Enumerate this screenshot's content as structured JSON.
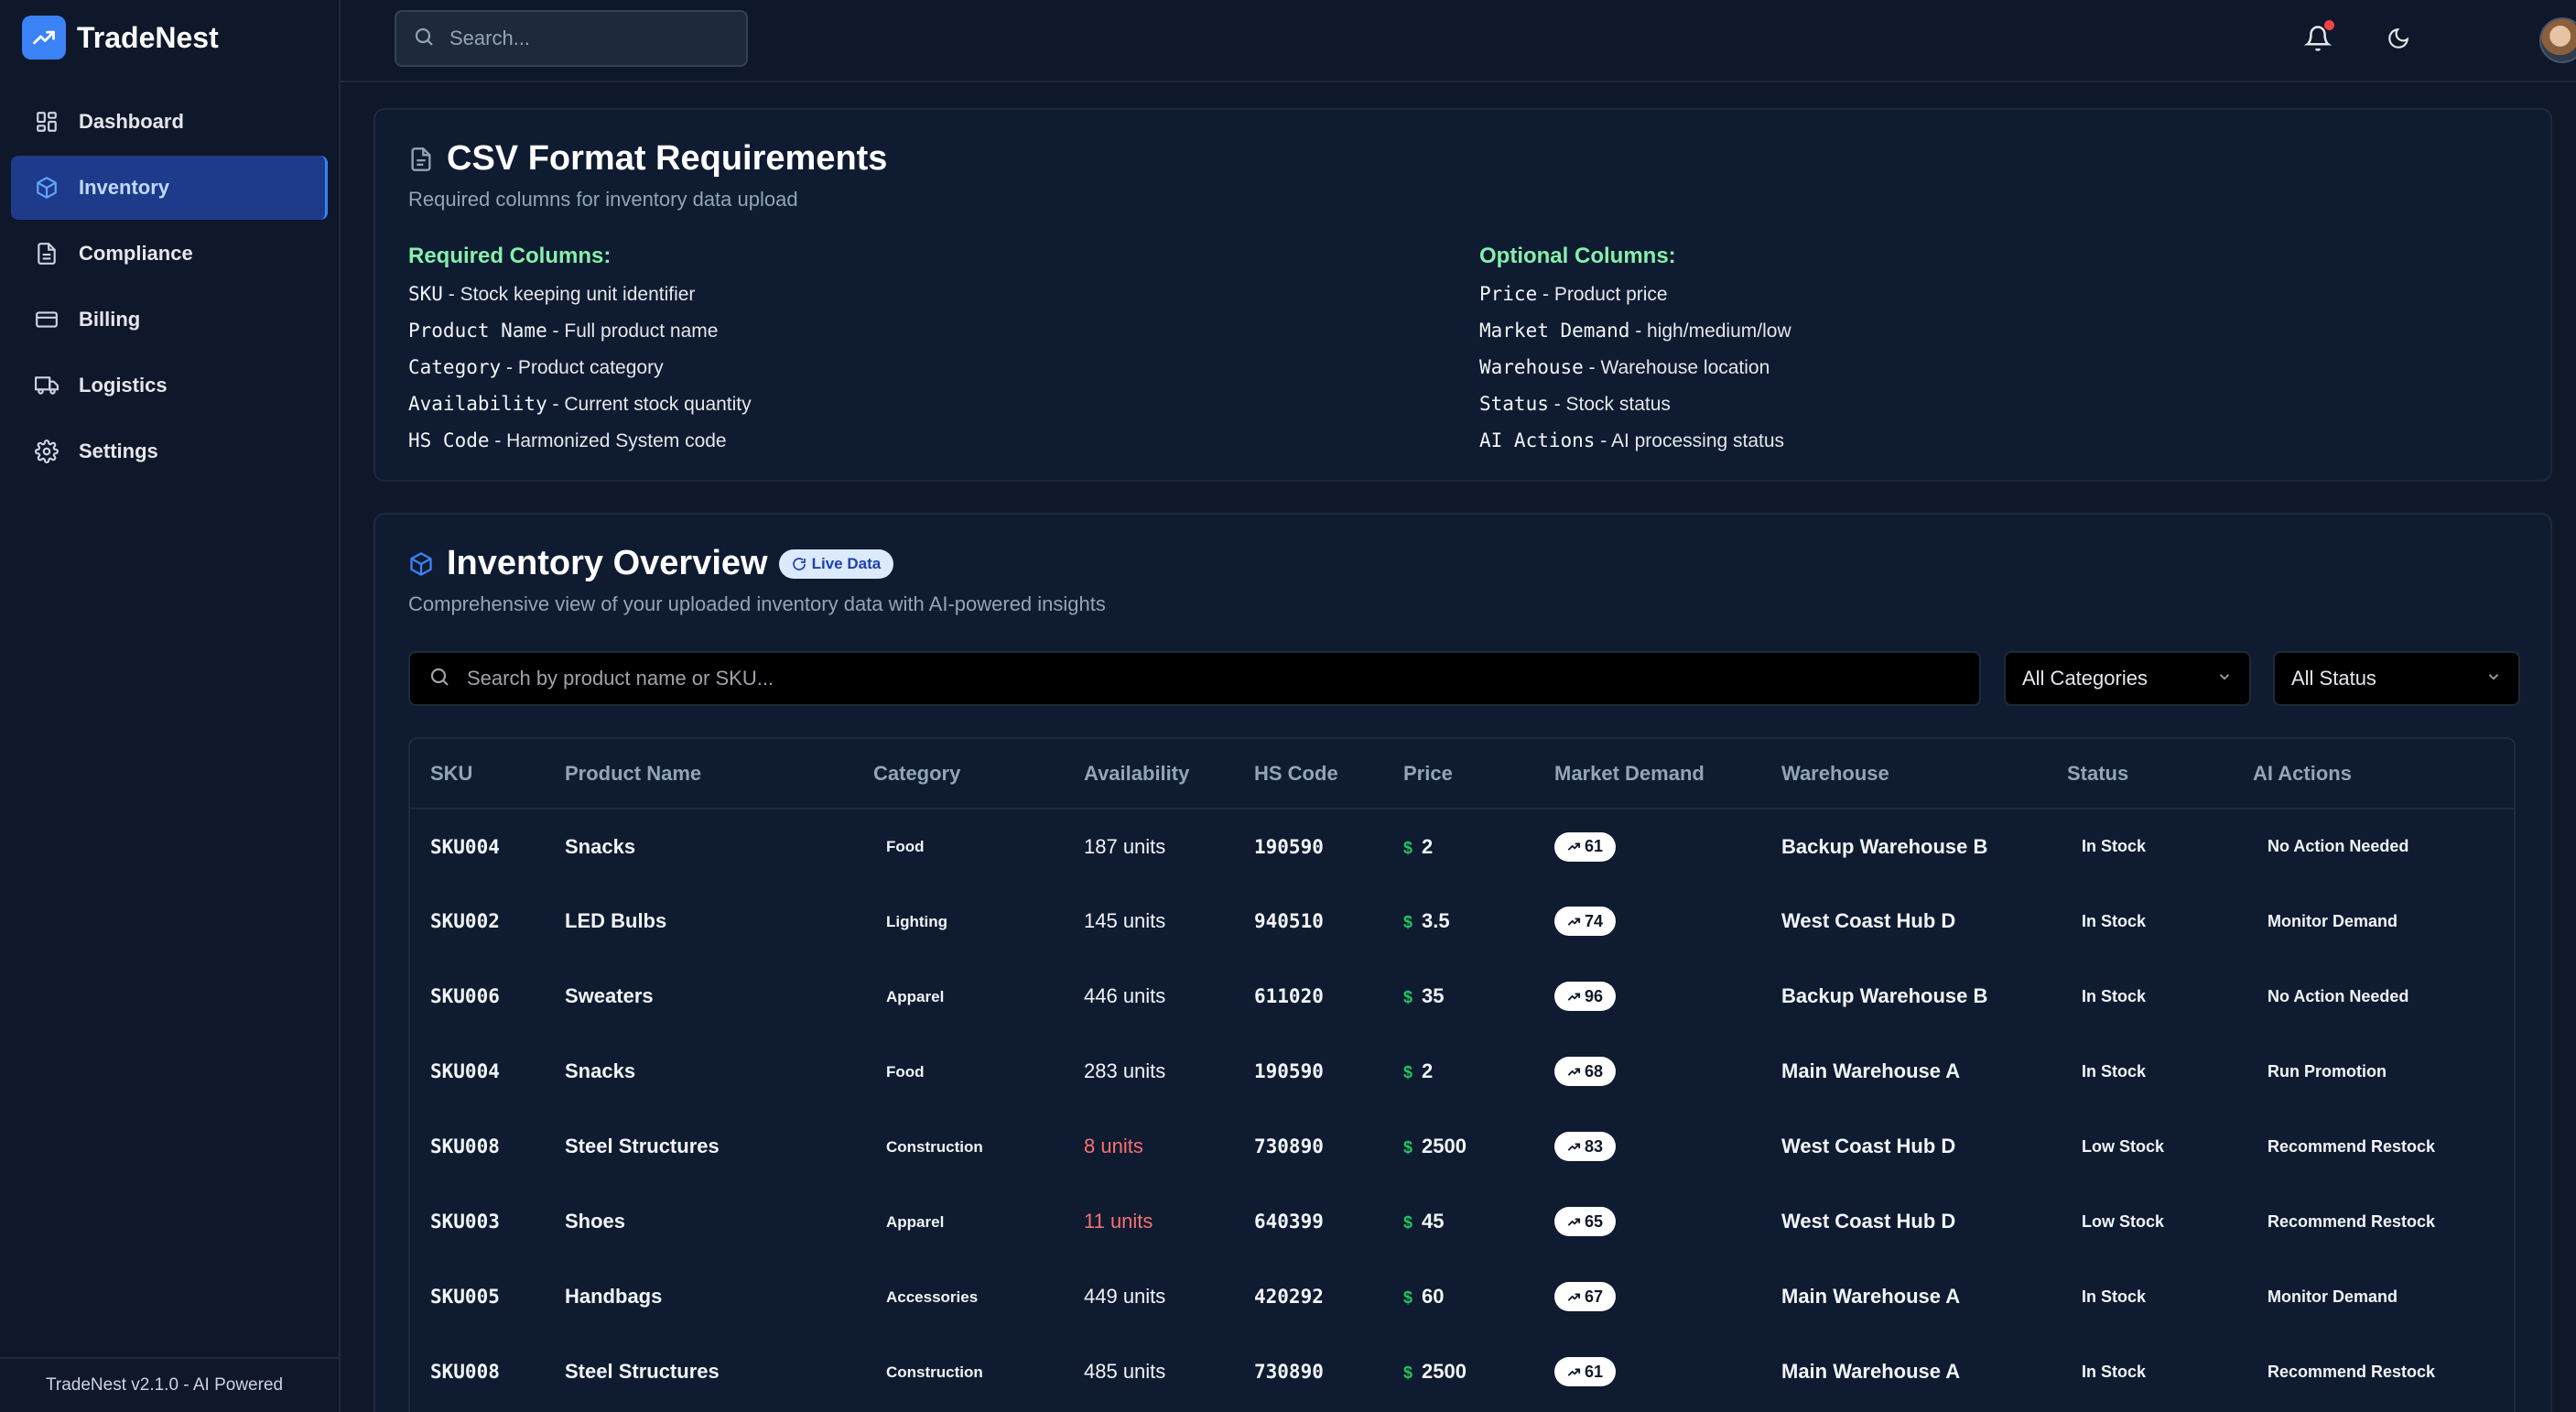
{
  "app": {
    "name": "TradeNest",
    "version_footer": "TradeNest v2.1.0 - AI Powered"
  },
  "topbar": {
    "search_placeholder": "Search..."
  },
  "sidebar": {
    "items": [
      {
        "label": "Dashboard",
        "icon": "dashboard-icon"
      },
      {
        "label": "Inventory",
        "icon": "box-icon",
        "active": true
      },
      {
        "label": "Compliance",
        "icon": "document-icon"
      },
      {
        "label": "Billing",
        "icon": "credit-card-icon"
      },
      {
        "label": "Logistics",
        "icon": "truck-icon"
      },
      {
        "label": "Settings",
        "icon": "gear-icon"
      }
    ]
  },
  "csv": {
    "title": "CSV Format Requirements",
    "subtitle": "Required columns for inventory data upload",
    "required_heading": "Required Columns:",
    "required": [
      {
        "code": "SKU",
        "desc": " - Stock keeping unit identifier"
      },
      {
        "code": "Product Name",
        "desc": " - Full product name"
      },
      {
        "code": "Category",
        "desc": " - Product category"
      },
      {
        "code": "Availability",
        "desc": " - Current stock quantity"
      },
      {
        "code": "HS Code",
        "desc": " - Harmonized System code"
      }
    ],
    "optional_heading": "Optional Columns:",
    "optional": [
      {
        "code": "Price",
        "desc": " - Product price"
      },
      {
        "code": "Market Demand",
        "desc": " - high/medium/low"
      },
      {
        "code": "Warehouse",
        "desc": " - Warehouse location"
      },
      {
        "code": "Status",
        "desc": " - Stock status"
      },
      {
        "code": "AI Actions",
        "desc": " - AI processing status"
      }
    ]
  },
  "inventory": {
    "title": "Inventory Overview",
    "badge": "Live Data",
    "subtitle": "Comprehensive view of your uploaded inventory data with AI-powered insights",
    "search_placeholder": "Search by product name or SKU...",
    "category_filter": "All Categories",
    "status_filter": "All Status",
    "columns": [
      "SKU",
      "Product Name",
      "Category",
      "Availability",
      "HS Code",
      "Price",
      "Market Demand",
      "Warehouse",
      "Status",
      "AI Actions"
    ],
    "rows": [
      {
        "sku": "SKU004",
        "name": "Snacks",
        "category": "Food",
        "availability": "187 units",
        "low": false,
        "hs": "190590",
        "price": "$2",
        "demand": "61",
        "warehouse": "Backup Warehouse B",
        "status": "In Stock",
        "ai": "No Action Needed"
      },
      {
        "sku": "SKU002",
        "name": "LED Bulbs",
        "category": "Lighting",
        "availability": "145 units",
        "low": false,
        "hs": "940510",
        "price": "$3.5",
        "demand": "74",
        "warehouse": "West Coast Hub D",
        "status": "In Stock",
        "ai": "Monitor Demand"
      },
      {
        "sku": "SKU006",
        "name": "Sweaters",
        "category": "Apparel",
        "availability": "446 units",
        "low": false,
        "hs": "611020",
        "price": "$35",
        "demand": "96",
        "warehouse": "Backup Warehouse B",
        "status": "In Stock",
        "ai": "No Action Needed"
      },
      {
        "sku": "SKU004",
        "name": "Snacks",
        "category": "Food",
        "availability": "283 units",
        "low": false,
        "hs": "190590",
        "price": "$2",
        "demand": "68",
        "warehouse": "Main Warehouse A",
        "status": "In Stock",
        "ai": "Run Promotion"
      },
      {
        "sku": "SKU008",
        "name": "Steel Structures",
        "category": "Construction",
        "availability": "8 units",
        "low": true,
        "hs": "730890",
        "price": "$2500",
        "demand": "83",
        "warehouse": "West Coast Hub D",
        "status": "Low Stock",
        "ai": "Recommend Restock"
      },
      {
        "sku": "SKU003",
        "name": "Shoes",
        "category": "Apparel",
        "availability": "11 units",
        "low": true,
        "hs": "640399",
        "price": "$45",
        "demand": "65",
        "warehouse": "West Coast Hub D",
        "status": "Low Stock",
        "ai": "Recommend Restock"
      },
      {
        "sku": "SKU005",
        "name": "Handbags",
        "category": "Accessories",
        "availability": "449 units",
        "low": false,
        "hs": "420292",
        "price": "$60",
        "demand": "67",
        "warehouse": "Main Warehouse A",
        "status": "In Stock",
        "ai": "Monitor Demand"
      },
      {
        "sku": "SKU008",
        "name": "Steel Structures",
        "category": "Construction",
        "availability": "485 units",
        "low": false,
        "hs": "730890",
        "price": "$2500",
        "demand": "61",
        "warehouse": "Main Warehouse A",
        "status": "In Stock",
        "ai": "Recommend Restock"
      }
    ]
  },
  "colors": {
    "accent": "#3b82f6",
    "background": "#0f172a",
    "required_heading": "#86efac",
    "low_stock": "#f87171",
    "price_dollar": "#22c55e"
  }
}
